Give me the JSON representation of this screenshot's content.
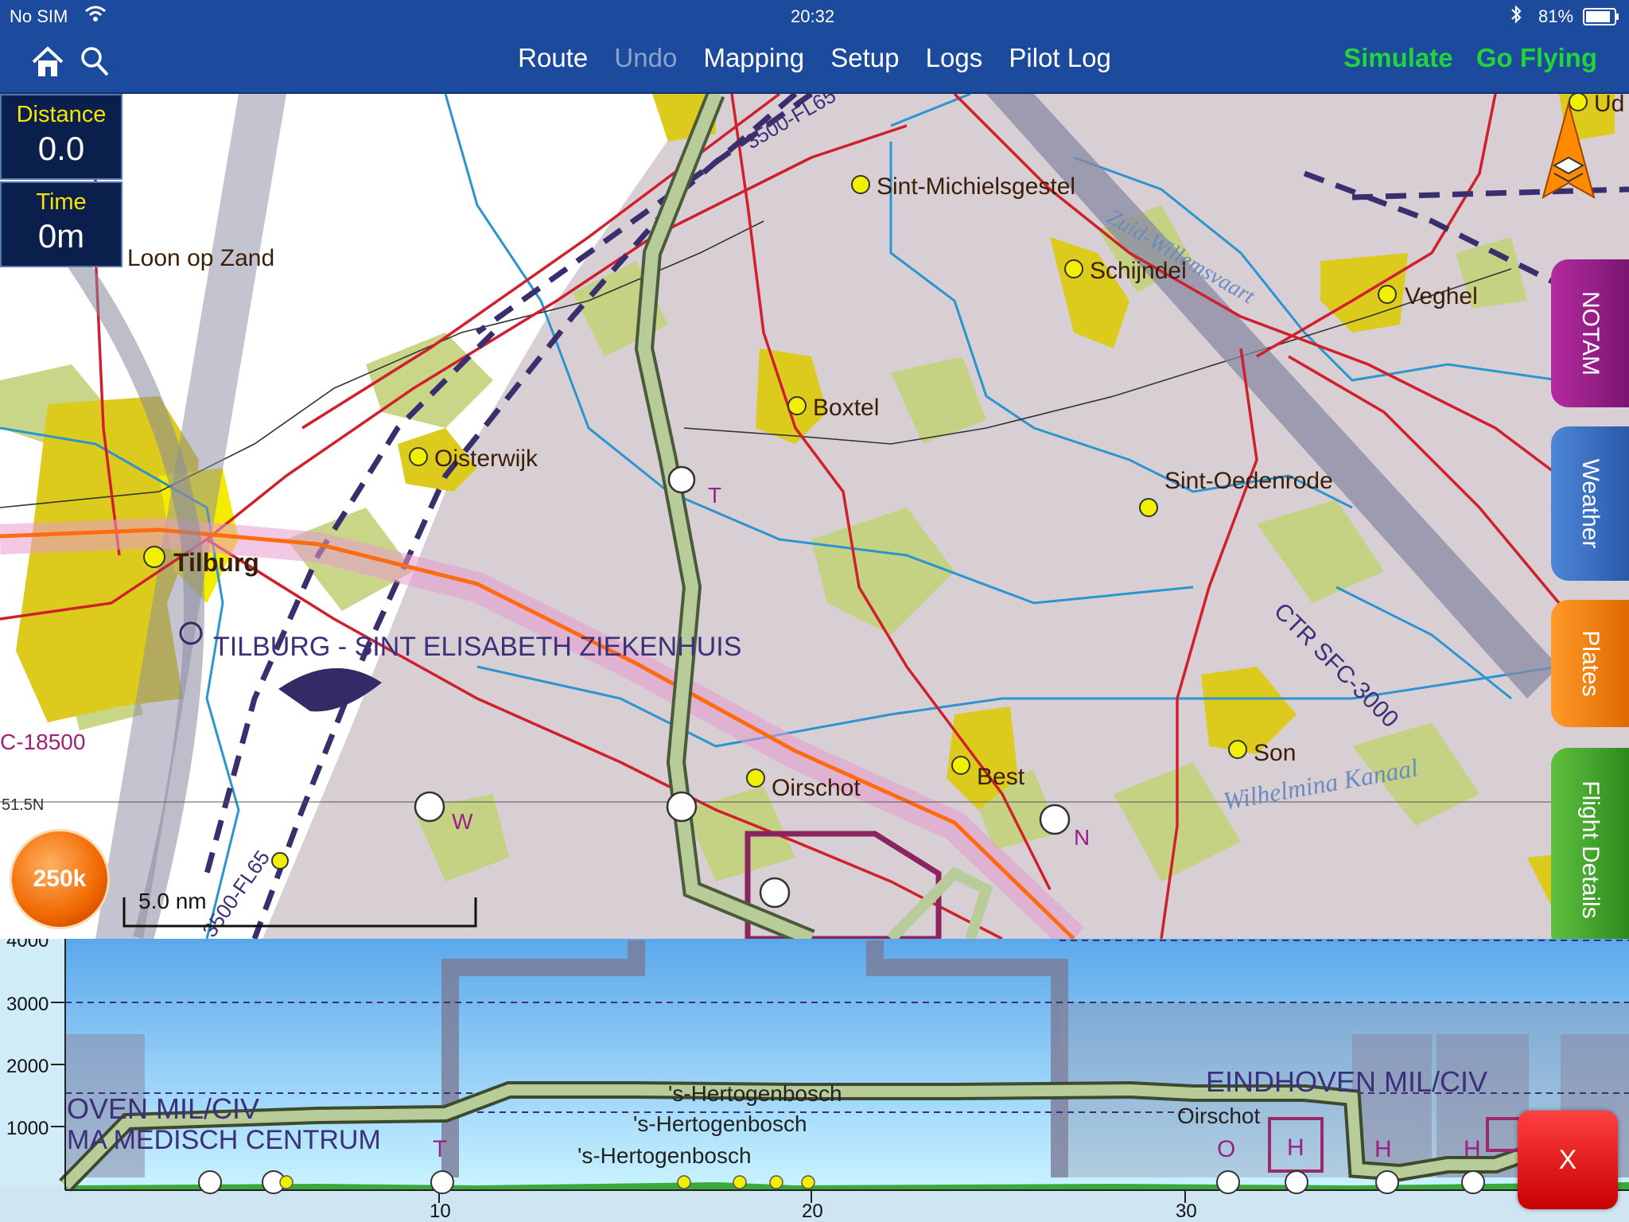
{
  "status": {
    "carrier": "No SIM",
    "time": "20:32",
    "battery": "81%"
  },
  "nav": {
    "route": "Route",
    "undo": "Undo",
    "mapping": "Mapping",
    "setup": "Setup",
    "logs": "Logs",
    "pilot_log": "Pilot Log",
    "simulate": "Simulate",
    "go_flying": "Go Flying"
  },
  "info": {
    "distance_label": "Distance",
    "distance_value": "0.0",
    "time_label": "Time",
    "time_value": "0m"
  },
  "zoom": {
    "label": "250k"
  },
  "scale": {
    "label": "5.0 nm"
  },
  "side_tabs": {
    "notam": "NOTAM",
    "weather": "Weather",
    "plates": "Plates",
    "flight_details": "Flight Details"
  },
  "map_labels": {
    "ud": "Ud",
    "sint_michielsgestel": "Sint-Michielsgestel",
    "loon_op_zand": "Loon op Zand",
    "schijndel": "Schijndel",
    "veghel": "Veghel",
    "boxtel": "Boxtel",
    "oisterwijk": "Oisterwijk",
    "sint_oedenrode": "Sint-Oedenrode",
    "tilburg": "Tilburg",
    "hospital": "TILBURG - SINT ELISABETH ZIEKENHUIS",
    "ctr": "CTR SFC-3000",
    "son": "Son",
    "best": "Best",
    "oirschot": "Oirschot",
    "kanaal": "Wilhelmina Kanaal",
    "zuid_willemsvaart": "Zuid-Willemsvaart",
    "lat": "51.5N",
    "airspace_top": "3500-FL65",
    "airspace_bottom": "3500-FL65",
    "airspace_left": "C-18500",
    "rp_t": "T",
    "rp_w": "W",
    "rp_n": "N"
  },
  "profile": {
    "y_ticks": [
      "4000",
      "3000",
      "2000",
      "1000"
    ],
    "x_ticks": [
      "10",
      "20",
      "30"
    ],
    "labels": {
      "eindhoven_left": "OVEN MIL/CIV",
      "medisch": "MA MEDISCH CENTRUM",
      "t": "T",
      "hb1": "'s-Hertogenbosch",
      "hb2": "'s-Hertogenbosch",
      "hb3": "'s-Hertogenbosch",
      "eindhoven_right": "EINDHOVEN MIL/CIV",
      "oirschot": "Oirschot",
      "o": "O",
      "h1": "H",
      "h2": "H",
      "h3": "H"
    }
  },
  "close": {
    "label": "X"
  },
  "colors": {
    "bar": "#1c4a9c",
    "accent_green": "#22d33a",
    "info_yellow": "#f5e600"
  }
}
